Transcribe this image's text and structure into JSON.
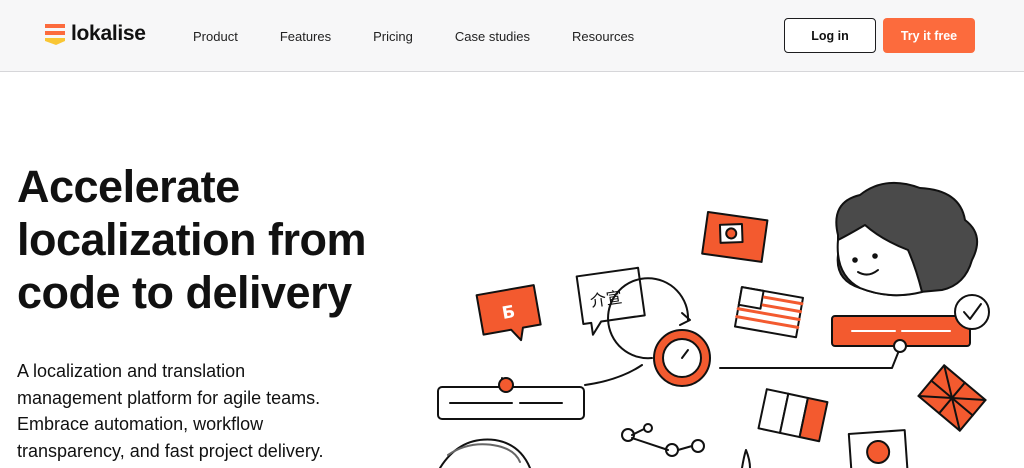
{
  "brand": {
    "name": "lokalise",
    "accent": "#fc6b3d",
    "logo_colors": [
      "#fc6b3d",
      "#f9c634"
    ]
  },
  "nav": {
    "items": [
      {
        "label": "Product"
      },
      {
        "label": "Features"
      },
      {
        "label": "Pricing"
      },
      {
        "label": "Case studies"
      },
      {
        "label": "Resources"
      }
    ]
  },
  "header": {
    "login_label": "Log in",
    "try_label": "Try it free"
  },
  "hero": {
    "title_lines": [
      "Accelerate",
      "localization from",
      "code to delivery"
    ],
    "subtitle_lines": [
      "A localization and translation",
      "management platform for agile teams.",
      "Embrace automation, workflow",
      "transparency, and fast project delivery."
    ]
  },
  "illustration": {
    "chips": [
      "Б",
      "介宣"
    ],
    "icons": [
      "flag-card-icon",
      "language-bubble-icon",
      "us-flag-icon",
      "clock-refresh-icon",
      "person-avatar-icon",
      "checkmark-badge-icon",
      "italian-flag-icon",
      "uk-flag-icon",
      "japan-flag-icon",
      "node-graph-icon",
      "string-bar-icon"
    ]
  }
}
